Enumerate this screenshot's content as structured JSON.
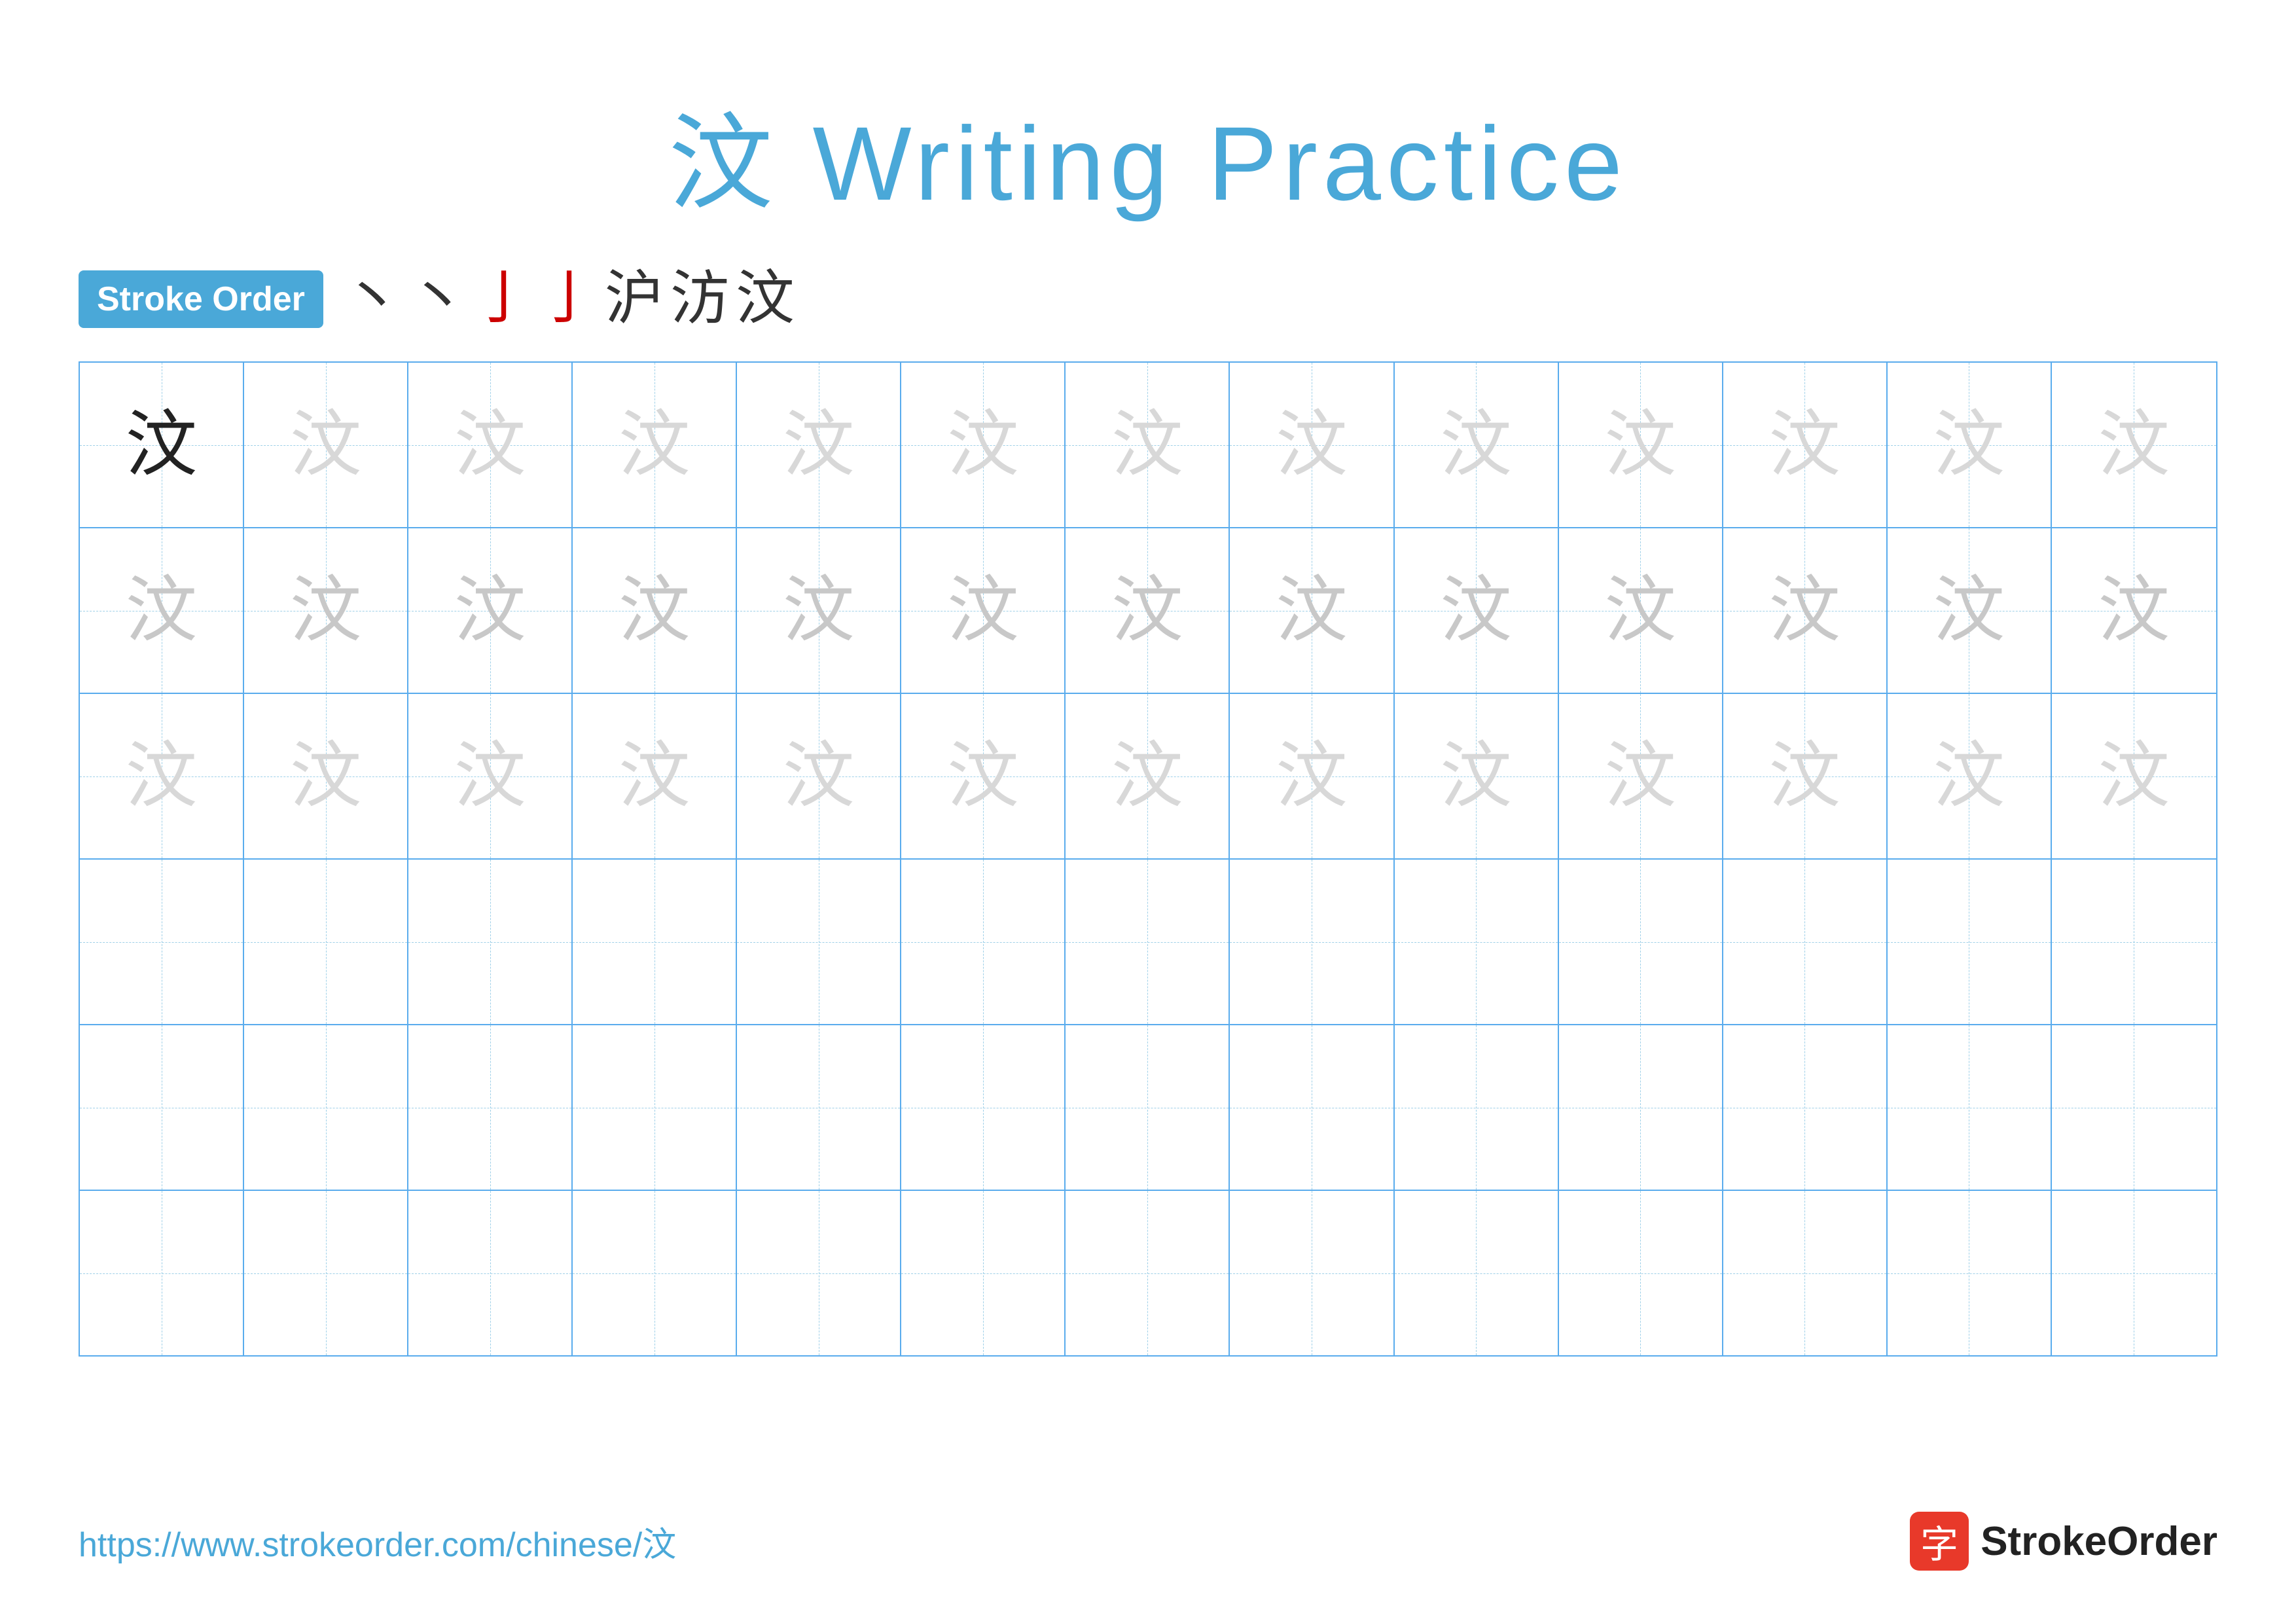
{
  "title": {
    "char": "汶",
    "label": "Writing Practice",
    "full": "汶 Writing Practice"
  },
  "stroke_order": {
    "badge_label": "Stroke Order",
    "strokes": [
      "丶",
      "丶",
      "亅",
      "亅",
      "沪",
      "汸",
      "汶"
    ]
  },
  "grid": {
    "rows": 6,
    "cols": 13,
    "char": "汶",
    "row_types": [
      "dark-first-rest-light",
      "medium",
      "light",
      "empty",
      "empty",
      "empty"
    ]
  },
  "footer": {
    "url": "https://www.strokeorder.com/chinese/汶",
    "logo_char": "字",
    "logo_name": "StrokeOrder"
  }
}
